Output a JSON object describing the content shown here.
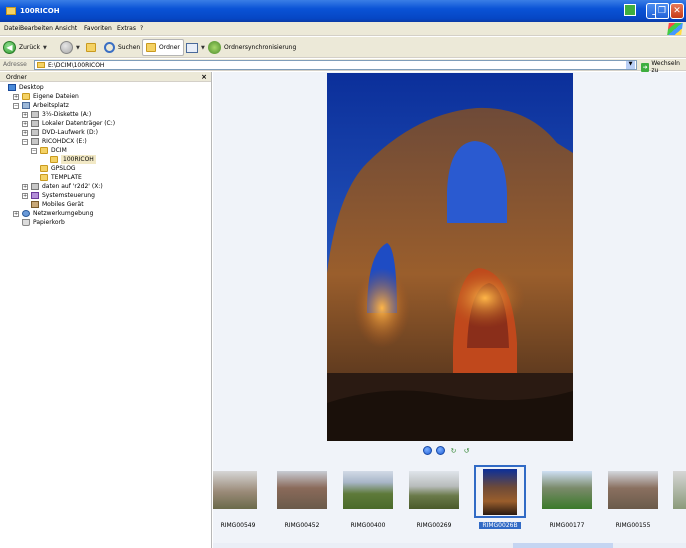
{
  "window": {
    "title": "100RICOH"
  },
  "menu": [
    "Datei",
    "Bearbeiten",
    "Ansicht",
    "Favoriten",
    "Extras",
    "?"
  ],
  "toolbar": {
    "back": "Zurück",
    "search": "Suchen",
    "folders": "Ordner",
    "sync": "Ordnersynchronisierung"
  },
  "address": {
    "label": "Adresse",
    "value": "E:\\DCIM\\100RICOH",
    "go": "Wechseln zu"
  },
  "folder_pane": {
    "title": "Ordner",
    "items": [
      {
        "label": "Desktop"
      },
      {
        "label": "Eigene Dateien"
      },
      {
        "label": "Arbeitsplatz"
      },
      {
        "label": "3½-Diskette (A:)"
      },
      {
        "label": "Lokaler Datenträger (C:)"
      },
      {
        "label": "DVD-Laufwerk (D:)"
      },
      {
        "label": "RICOHDCX (E:)"
      },
      {
        "label": "DCIM"
      },
      {
        "label": "100RICOH"
      },
      {
        "label": "GPSLOG"
      },
      {
        "label": "TEMPLATE"
      },
      {
        "label": "daten auf 'r2d2' (X:)"
      },
      {
        "label": "Systemsteuerung"
      },
      {
        "label": "Mobiles Gerät"
      },
      {
        "label": "Netzwerkumgebung"
      },
      {
        "label": "Papierkorb"
      }
    ]
  },
  "filmstrip": {
    "selected": "RIMG0026B",
    "items": [
      {
        "label": "RIMG00549"
      },
      {
        "label": "RIMG00452"
      },
      {
        "label": "RIMG00400"
      },
      {
        "label": "RIMG00269"
      },
      {
        "label": "RIMG0026B"
      },
      {
        "label": "RIMG00177"
      },
      {
        "label": "RIMG00155"
      }
    ]
  },
  "colors": {
    "titlebar": "#0a53d6",
    "selection": "#316ac5",
    "chrome": "#ece9d8"
  }
}
